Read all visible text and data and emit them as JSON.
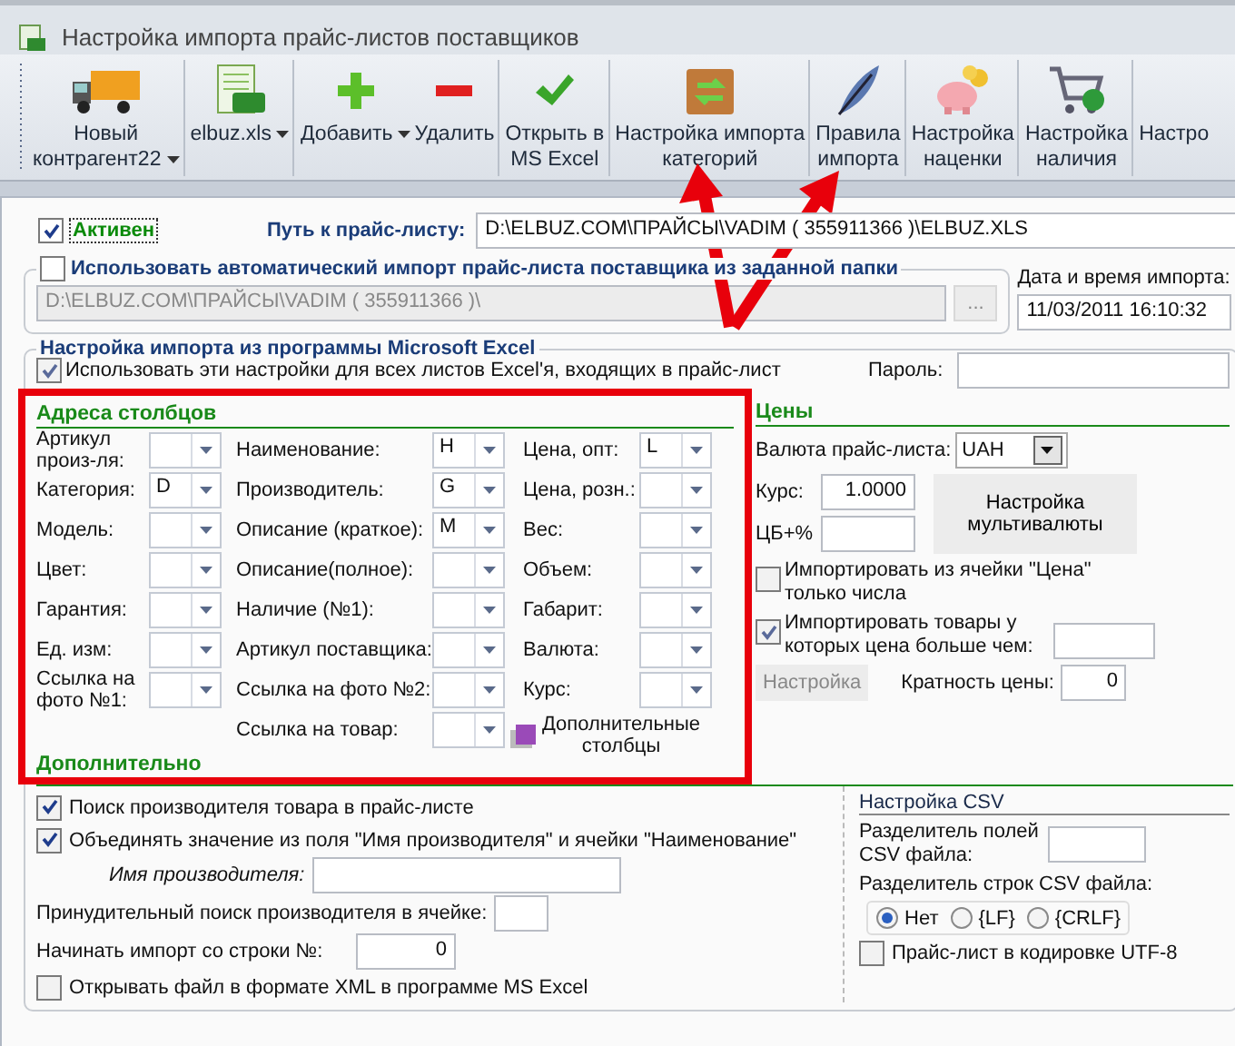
{
  "window": {
    "title": "Настройка импорта прайс-листов поставщиков"
  },
  "toolbar": [
    {
      "label": "Новый\nконтрагент22",
      "dropdown": true,
      "separator_after": true
    },
    {
      "label": "elbuz.xls",
      "dropdown": true,
      "separator_after": true
    },
    {
      "label": "Добавить",
      "dropdown": true,
      "separator_after": false
    },
    {
      "label": "Удалить",
      "dropdown": false,
      "separator_after": true
    },
    {
      "label": "Открыть в\nMS Excel",
      "dropdown": false,
      "separator_after": true
    },
    {
      "label": "Настройка импорта\nкатегорий",
      "dropdown": false,
      "separator_after": true
    },
    {
      "label": "Правила\nимпорта",
      "dropdown": false,
      "separator_after": true
    },
    {
      "label": "Настройка\nнаценки",
      "dropdown": false,
      "separator_after": true
    },
    {
      "label": "Настройка\nналичия",
      "dropdown": false,
      "separator_after": true
    },
    {
      "label": "Настро",
      "dropdown": false,
      "separator_after": false
    }
  ],
  "active": {
    "label": "Активен",
    "checked": true
  },
  "path": {
    "label": "Путь к прайс-листу:",
    "value": "D:\\ELBUZ.COM\\ПРАЙСЫ\\VADIM ( 355911366 )\\ELBUZ.XLS"
  },
  "auto_import": {
    "label": "Использовать автоматический импорт прайс-листа поставщика из заданной папки",
    "checked": false,
    "folder": "D:\\ELBUZ.COM\\ПРАЙСЫ\\VADIM ( 355911366 )\\",
    "browse": {
      "label": "...",
      "disabled": true
    },
    "date_label": "Дата и время импорта:",
    "date": "11/03/2011 16:10:32"
  },
  "excel": {
    "title": "Настройка импорта из программы Microsoft Excel",
    "all_sheets": {
      "label": "Использовать эти настройки для всех листов Excel'я, входящих в прайс-лист",
      "checked": true
    },
    "password_label": "Пароль:",
    "columns_title": "Адреса столбцов",
    "columns": [
      [
        {
          "label": "Артикул произ-ля:"
        },
        {
          "label": "Категория:",
          "value": "D"
        },
        {
          "label": "Модель:"
        },
        {
          "label": "Цвет:"
        },
        {
          "label": "Гарантия:"
        },
        {
          "label": "Ед. изм:"
        },
        {
          "label": "Ссылка на фото №1:"
        }
      ],
      [
        {
          "label": "Наименование:",
          "value": "H"
        },
        {
          "label": "Производитель:",
          "value": "G"
        },
        {
          "label": "Описание (краткое):",
          "value": "M"
        },
        {
          "label": "Описание(полное):"
        },
        {
          "label": "Наличие (№1):"
        },
        {
          "label": "Артикул поставщика:"
        },
        {
          "label": "Ссылка на фото №2:"
        },
        {
          "label": "Ссылка на товар:"
        }
      ],
      [
        {
          "label": "Цена, опт:",
          "value": "L"
        },
        {
          "label": "Цена, розн.:"
        },
        {
          "label": "Вес:"
        },
        {
          "label": "Объем:"
        },
        {
          "label": "Габарит:"
        },
        {
          "label": "Валюта:"
        },
        {
          "label": "Курс:"
        }
      ]
    ],
    "extra_columns": "Дополнительные столбцы",
    "extra_title": "Дополнительно",
    "prices": {
      "title": "Цены",
      "currency_label": "Валюта прайс-листа:",
      "currency": "UAH",
      "rate_label": "Курс:",
      "rate": "1.0000",
      "cb_label": "ЦБ+%",
      "multicurrency": "Настройка мультивалюты",
      "only_numbers": {
        "label": "Импортировать из ячейки \"Цена\" только числа",
        "checked": false
      },
      "min_price": {
        "label": "Импортировать товары у которых цена больше чем:",
        "checked": true
      },
      "setup": {
        "label": "Настройка",
        "disabled": true
      },
      "multiple_label": "Кратность цены:",
      "multiple": "0"
    },
    "search_manufacturer": {
      "label": "Поиск производителя товара в прайс-листе",
      "checked": true
    },
    "merge_names": {
      "label": "Объединять значение из поля \"Имя производителя\" и ячейки \"Наименование\"",
      "checked": true
    },
    "manufacturer_label": "Имя производителя:",
    "forced_search_label": "Принудительный поиск производителя в ячейке:",
    "start_row_label": "Начинать импорт со строки №:",
    "start_row": "0",
    "xml": {
      "label": "Открывать файл в формате XML в программе MS Excel",
      "checked": false
    },
    "csv": {
      "title": "Настройка CSV",
      "field_sep_label": "Разделитель полей CSV файла:",
      "line_sep_label": "Разделитель строк CSV файла:",
      "line_separators": [
        {
          "label": "Нет",
          "selected": true
        },
        {
          "label": "{LF}",
          "selected": false
        },
        {
          "label": "{CRLF}",
          "selected": false
        }
      ],
      "utf8": {
        "label": "Прайс-лист в кодировке UTF-8",
        "checked": false
      }
    }
  }
}
